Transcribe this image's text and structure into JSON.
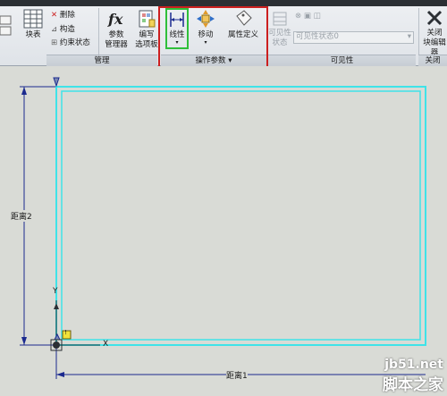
{
  "ribbon": {
    "block_table": "块表",
    "delete": "删除",
    "construct": "构造",
    "constraint_state": "约束状态",
    "param_manager_1": "参数",
    "param_manager_2": "管理器",
    "edit_options_1": "编写",
    "edit_options_2": "选项板",
    "linear": "线性",
    "move": "移动",
    "attribute_define": "属性定义",
    "visibility_state_1": "可见性",
    "visibility_state_2": "状态",
    "visibility_dropdown": "可见性状态0",
    "close_1": "关闭",
    "close_2": "块编辑器",
    "groups": {
      "manage": "管理",
      "action_params": "操作参数",
      "visibility": "可见性",
      "close": "关闭"
    }
  },
  "canvas": {
    "dim_vertical": "距离2",
    "dim_horizontal": "距离1",
    "axis_y": "Y",
    "axis_x": "X",
    "warning_mark": "!"
  },
  "watermark": {
    "site": "jb51.net",
    "name": "脚本之家"
  },
  "colors": {
    "highlight_red": "#cc1f1f",
    "highlight_green": "#2fbf3a",
    "rect_cyan": "#3fe3e8",
    "dim_blue": "#1b2a8f"
  }
}
